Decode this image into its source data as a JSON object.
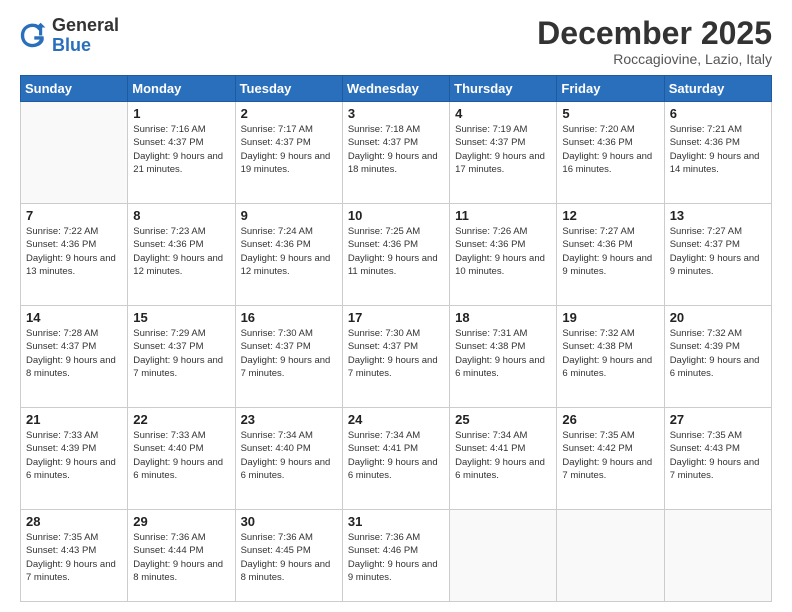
{
  "header": {
    "logo_general": "General",
    "logo_blue": "Blue",
    "month_title": "December 2025",
    "location": "Roccagiovine, Lazio, Italy"
  },
  "weekdays": [
    "Sunday",
    "Monday",
    "Tuesday",
    "Wednesday",
    "Thursday",
    "Friday",
    "Saturday"
  ],
  "weeks": [
    [
      {
        "day": "",
        "sunrise": "",
        "sunset": "",
        "daylight": ""
      },
      {
        "day": "1",
        "sunrise": "Sunrise: 7:16 AM",
        "sunset": "Sunset: 4:37 PM",
        "daylight": "Daylight: 9 hours and 21 minutes."
      },
      {
        "day": "2",
        "sunrise": "Sunrise: 7:17 AM",
        "sunset": "Sunset: 4:37 PM",
        "daylight": "Daylight: 9 hours and 19 minutes."
      },
      {
        "day": "3",
        "sunrise": "Sunrise: 7:18 AM",
        "sunset": "Sunset: 4:37 PM",
        "daylight": "Daylight: 9 hours and 18 minutes."
      },
      {
        "day": "4",
        "sunrise": "Sunrise: 7:19 AM",
        "sunset": "Sunset: 4:37 PM",
        "daylight": "Daylight: 9 hours and 17 minutes."
      },
      {
        "day": "5",
        "sunrise": "Sunrise: 7:20 AM",
        "sunset": "Sunset: 4:36 PM",
        "daylight": "Daylight: 9 hours and 16 minutes."
      },
      {
        "day": "6",
        "sunrise": "Sunrise: 7:21 AM",
        "sunset": "Sunset: 4:36 PM",
        "daylight": "Daylight: 9 hours and 14 minutes."
      }
    ],
    [
      {
        "day": "7",
        "sunrise": "Sunrise: 7:22 AM",
        "sunset": "Sunset: 4:36 PM",
        "daylight": "Daylight: 9 hours and 13 minutes."
      },
      {
        "day": "8",
        "sunrise": "Sunrise: 7:23 AM",
        "sunset": "Sunset: 4:36 PM",
        "daylight": "Daylight: 9 hours and 12 minutes."
      },
      {
        "day": "9",
        "sunrise": "Sunrise: 7:24 AM",
        "sunset": "Sunset: 4:36 PM",
        "daylight": "Daylight: 9 hours and 12 minutes."
      },
      {
        "day": "10",
        "sunrise": "Sunrise: 7:25 AM",
        "sunset": "Sunset: 4:36 PM",
        "daylight": "Daylight: 9 hours and 11 minutes."
      },
      {
        "day": "11",
        "sunrise": "Sunrise: 7:26 AM",
        "sunset": "Sunset: 4:36 PM",
        "daylight": "Daylight: 9 hours and 10 minutes."
      },
      {
        "day": "12",
        "sunrise": "Sunrise: 7:27 AM",
        "sunset": "Sunset: 4:36 PM",
        "daylight": "Daylight: 9 hours and 9 minutes."
      },
      {
        "day": "13",
        "sunrise": "Sunrise: 7:27 AM",
        "sunset": "Sunset: 4:37 PM",
        "daylight": "Daylight: 9 hours and 9 minutes."
      }
    ],
    [
      {
        "day": "14",
        "sunrise": "Sunrise: 7:28 AM",
        "sunset": "Sunset: 4:37 PM",
        "daylight": "Daylight: 9 hours and 8 minutes."
      },
      {
        "day": "15",
        "sunrise": "Sunrise: 7:29 AM",
        "sunset": "Sunset: 4:37 PM",
        "daylight": "Daylight: 9 hours and 7 minutes."
      },
      {
        "day": "16",
        "sunrise": "Sunrise: 7:30 AM",
        "sunset": "Sunset: 4:37 PM",
        "daylight": "Daylight: 9 hours and 7 minutes."
      },
      {
        "day": "17",
        "sunrise": "Sunrise: 7:30 AM",
        "sunset": "Sunset: 4:37 PM",
        "daylight": "Daylight: 9 hours and 7 minutes."
      },
      {
        "day": "18",
        "sunrise": "Sunrise: 7:31 AM",
        "sunset": "Sunset: 4:38 PM",
        "daylight": "Daylight: 9 hours and 6 minutes."
      },
      {
        "day": "19",
        "sunrise": "Sunrise: 7:32 AM",
        "sunset": "Sunset: 4:38 PM",
        "daylight": "Daylight: 9 hours and 6 minutes."
      },
      {
        "day": "20",
        "sunrise": "Sunrise: 7:32 AM",
        "sunset": "Sunset: 4:39 PM",
        "daylight": "Daylight: 9 hours and 6 minutes."
      }
    ],
    [
      {
        "day": "21",
        "sunrise": "Sunrise: 7:33 AM",
        "sunset": "Sunset: 4:39 PM",
        "daylight": "Daylight: 9 hours and 6 minutes."
      },
      {
        "day": "22",
        "sunrise": "Sunrise: 7:33 AM",
        "sunset": "Sunset: 4:40 PM",
        "daylight": "Daylight: 9 hours and 6 minutes."
      },
      {
        "day": "23",
        "sunrise": "Sunrise: 7:34 AM",
        "sunset": "Sunset: 4:40 PM",
        "daylight": "Daylight: 9 hours and 6 minutes."
      },
      {
        "day": "24",
        "sunrise": "Sunrise: 7:34 AM",
        "sunset": "Sunset: 4:41 PM",
        "daylight": "Daylight: 9 hours and 6 minutes."
      },
      {
        "day": "25",
        "sunrise": "Sunrise: 7:34 AM",
        "sunset": "Sunset: 4:41 PM",
        "daylight": "Daylight: 9 hours and 6 minutes."
      },
      {
        "day": "26",
        "sunrise": "Sunrise: 7:35 AM",
        "sunset": "Sunset: 4:42 PM",
        "daylight": "Daylight: 9 hours and 7 minutes."
      },
      {
        "day": "27",
        "sunrise": "Sunrise: 7:35 AM",
        "sunset": "Sunset: 4:43 PM",
        "daylight": "Daylight: 9 hours and 7 minutes."
      }
    ],
    [
      {
        "day": "28",
        "sunrise": "Sunrise: 7:35 AM",
        "sunset": "Sunset: 4:43 PM",
        "daylight": "Daylight: 9 hours and 7 minutes."
      },
      {
        "day": "29",
        "sunrise": "Sunrise: 7:36 AM",
        "sunset": "Sunset: 4:44 PM",
        "daylight": "Daylight: 9 hours and 8 minutes."
      },
      {
        "day": "30",
        "sunrise": "Sunrise: 7:36 AM",
        "sunset": "Sunset: 4:45 PM",
        "daylight": "Daylight: 9 hours and 8 minutes."
      },
      {
        "day": "31",
        "sunrise": "Sunrise: 7:36 AM",
        "sunset": "Sunset: 4:46 PM",
        "daylight": "Daylight: 9 hours and 9 minutes."
      },
      {
        "day": "",
        "sunrise": "",
        "sunset": "",
        "daylight": ""
      },
      {
        "day": "",
        "sunrise": "",
        "sunset": "",
        "daylight": ""
      },
      {
        "day": "",
        "sunrise": "",
        "sunset": "",
        "daylight": ""
      }
    ]
  ]
}
